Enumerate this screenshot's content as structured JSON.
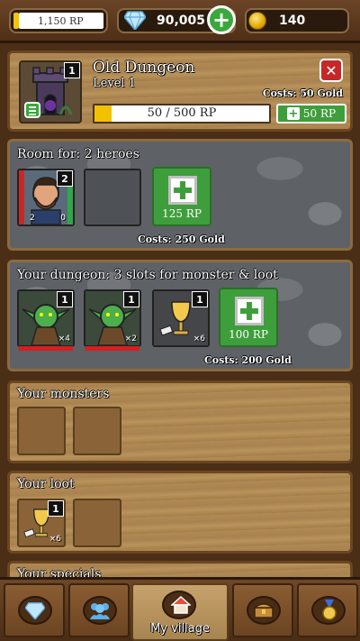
{
  "topbar": {
    "rp": "1,150 RP",
    "gems": "90,005",
    "gold": "140"
  },
  "dungeon": {
    "name": "Old Dungeon",
    "level": "Level 1",
    "count": "1",
    "upgrade_cost": "Costs: 50 Gold",
    "progress_text": "50 / 500 RP",
    "progress_fraction": 0.1,
    "upgrade_label": "50 RP"
  },
  "heroes": {
    "title": "Room for: 2 heroes",
    "hero_count": "2",
    "hero_potion_red": "2",
    "hero_potion_green": "0",
    "add_label": "125 RP",
    "cost": "Costs: 250 Gold"
  },
  "slots": {
    "title": "Your dungeon: 3 slots for monster & loot",
    "items": [
      {
        "count": "1",
        "qty": "×4"
      },
      {
        "count": "1",
        "qty": "×2"
      },
      {
        "count": "1",
        "qty": "×6"
      }
    ],
    "add_label": "100 RP",
    "cost": "Costs: 200 Gold"
  },
  "monsters": {
    "title": "Your monsters"
  },
  "loot": {
    "title": "Your loot",
    "count": "1",
    "qty": "×6"
  },
  "specials": {
    "title": "Your specials"
  },
  "nav": {
    "active_label": "My village"
  },
  "colors": {
    "green": "#3e9e3b",
    "gold_bar": "#f2c200",
    "red": "#d81e1e"
  }
}
